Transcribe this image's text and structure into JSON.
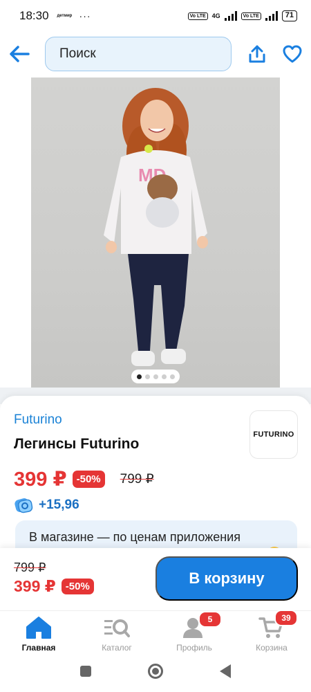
{
  "status_bar": {
    "time": "18:30",
    "mini_logo": "детмир",
    "dots": "···",
    "network": "4G",
    "volte_1": "Vo LTE",
    "volte_2": "Vo LTE",
    "battery": "71"
  },
  "header": {
    "search_placeholder": "Поиск",
    "back_icon": "arrow-left-icon",
    "share_icon": "share-icon",
    "favorite_icon": "heart-icon"
  },
  "gallery": {
    "page_count": 5,
    "active_page": 1
  },
  "product": {
    "brand": "Futurino",
    "brand_logo_text": "FUTURINO",
    "title": "Легинсы Futurino",
    "price": "399 ₽",
    "discount": "-50%",
    "old_price": "799 ₽",
    "bonus": "+15,96"
  },
  "promo": {
    "text": "В магазине — по ценам приложения"
  },
  "buy_bar": {
    "old_price": "799 ₽",
    "price": "399 ₽",
    "discount": "-50%",
    "cart_button": "В корзину"
  },
  "tabbar": {
    "items": [
      {
        "label": "Главная",
        "icon": "home-icon",
        "active": true
      },
      {
        "label": "Каталог",
        "icon": "catalog-search-icon",
        "active": false
      },
      {
        "label": "Профиль",
        "icon": "profile-icon",
        "active": false,
        "badge": "5"
      },
      {
        "label": "Корзина",
        "icon": "cart-icon",
        "active": false,
        "badge": "39"
      }
    ]
  },
  "colors": {
    "accent_blue": "#1a7fe0",
    "price_red": "#e53535",
    "search_bg": "#e8f3fc"
  }
}
